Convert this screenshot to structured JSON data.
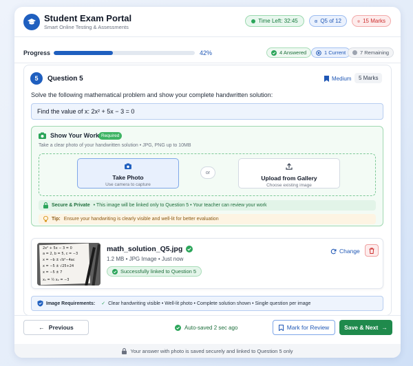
{
  "header": {
    "title": "Student Exam Portal",
    "subtitle": "Smart Online Testing & Assessments",
    "time_left": "Time Left: 32:45",
    "question_position": "Q5 of 12",
    "marks_total": "15 Marks"
  },
  "progress": {
    "label": "Progress",
    "percent_text": "42%",
    "fraction": 0.42,
    "answered": "4 Answered",
    "current": "1 Current",
    "remaining": "7 Remaining"
  },
  "question": {
    "number": "5",
    "title": "Question 5",
    "difficulty": "Medium",
    "marks": "5 Marks",
    "instruction": "Solve the following mathematical problem and show your complete handwritten solution:",
    "problem": "Find the value of x: 2x² + 5x − 3 = 0"
  },
  "work": {
    "title": "Show Your Work",
    "required_badge": "Required",
    "hint": "Take a clear photo of your handwritten solution • JPG, PNG up to 10MB",
    "take_photo_label": "Take Photo",
    "take_photo_sub": "Use camera to capture",
    "or_label": "or",
    "upload_label": "Upload from Gallery",
    "upload_sub": "Choose existing image",
    "secure_title": "Secure & Private",
    "secure_text": "• This image will be linked only to Question 5 • Your teacher can review your work",
    "tip_title": "Tip:",
    "tip_text": "Ensure your handwriting is clearly visible and well-lit for better evaluation"
  },
  "upload": {
    "filename": "math_solution_Q5.jpg",
    "meta": "1.2 MB • JPG Image • Just now",
    "linked_text": "Successfully linked to Question 5",
    "change_label": "Change"
  },
  "requirements": {
    "title": "Image Requirements:",
    "items": "Clear handwriting visible • Well-lit photo • Complete solution shown • Single question per image"
  },
  "footer": {
    "previous": "Previous",
    "autosaved": "Auto-saved 2 sec ago",
    "mark_review": "Mark for Review",
    "save_next": "Save & Next",
    "note": "Your answer with photo is saved securely and linked to Question 5 only"
  },
  "thumbnail_lines": [
    "2x² + 5x − 3 = 0",
    "a = 2, b = 5, c = −3",
    "x = −b ± √b²−4ac",
    "x = −5 ± √25+24",
    "x = −5 ± 7",
    "x₁ = ½   x₂ = −3"
  ],
  "colors": {
    "primary": "#1f5fbf",
    "success": "#1f8a4c",
    "danger": "#cc2d2d"
  }
}
